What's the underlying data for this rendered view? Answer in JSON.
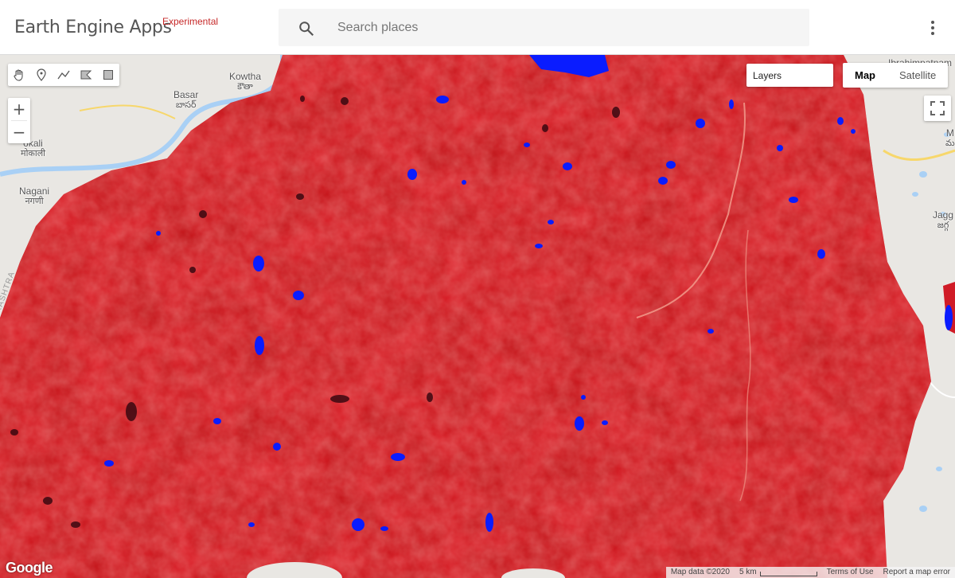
{
  "app": {
    "title": "Earth Engine Apps",
    "badge": "Experimental"
  },
  "search": {
    "placeholder": "Search places",
    "value": ""
  },
  "toolbar": {
    "more_icon": "more-vert-icon"
  },
  "draw_tools": [
    "hand-pan-icon",
    "marker-icon",
    "polyline-icon",
    "polygon-icon",
    "rectangle-icon"
  ],
  "zoom": {
    "in_label": "+",
    "out_label": "−"
  },
  "layers": {
    "label": "Layers"
  },
  "map_type": {
    "options": [
      "Map",
      "Satellite"
    ],
    "selected": "Map"
  },
  "places": {
    "kowtha": "Kowtha",
    "kowtha_te": "కౌతా",
    "basar": "Basar",
    "basar_te": "బాసర్",
    "okali": "okali",
    "okali_hi": "मोकाली",
    "nagani": "Nagani",
    "nagani_hi": "नगणी",
    "ibrahimpatnam": "Ibrahimpatnam",
    "jagg": "Jagg",
    "jagg_te": "జగ్గ",
    "m": "M",
    "m_te": "మ",
    "state": "RASHTRA"
  },
  "footer": {
    "logo": "Google",
    "map_data": "Map data ©2020",
    "scale": "5 km",
    "terms": "Terms of Use",
    "report": "Report a map error"
  },
  "colors": {
    "vegetation": "#e0202a",
    "water": "#0a1cff",
    "basemap": "#e9e7e3",
    "river": "#a9d0f5",
    "road": "#f7d76b",
    "experimental": "#c62828"
  }
}
